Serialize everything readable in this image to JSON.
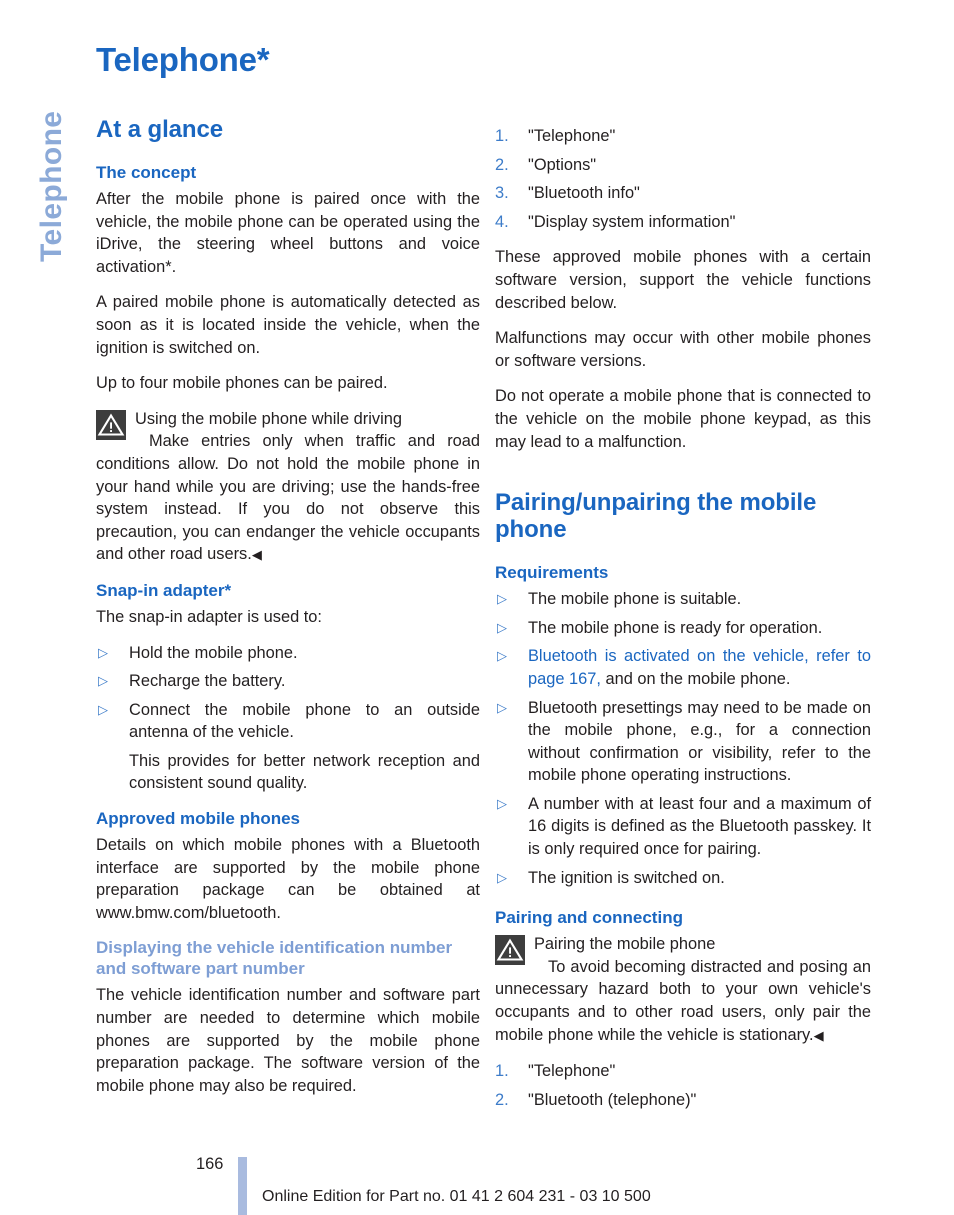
{
  "colors": {
    "heading_blue": "#1a66c0",
    "heading_blue_light": "#7e9ed4",
    "marker_blue": "#3d7cc9",
    "side_tab_blue": "#8caad8",
    "footer_bar": "#a9bbdf",
    "warning_icon_bg": "#3d3d3d",
    "body_text": "#231f20"
  },
  "side_tab": {
    "label": "Telephone"
  },
  "title": "Telephone*",
  "left_column": {
    "section_heading": "At a glance",
    "sub1": {
      "heading": "The concept",
      "paragraphs": [
        "After the mobile phone is paired once with the vehicle, the mobile phone can be operated using the iDrive, the steering wheel buttons and voice activation*.",
        "A paired mobile phone is automatically detected as soon as it is located inside the vehicle, when the ignition is switched on.",
        "Up to four mobile phones can be paired."
      ]
    },
    "warning": {
      "icon": "warning-triangle-icon",
      "title": "Using the mobile phone while driving",
      "body": "Make entries only when traffic and road conditions allow. Do not hold the mobile phone in your hand while you are driving; use the hands-free system instead. If you do not observe this precaution, you can endanger the vehicle occupants and other road users.",
      "end_marker": "◀"
    },
    "sub2": {
      "heading": "Snap-in adapter*",
      "intro": "The snap-in adapter is used to:",
      "bullets": [
        {
          "marker": "▷",
          "text": "Hold the mobile phone."
        },
        {
          "marker": "▷",
          "text": "Recharge the battery."
        },
        {
          "marker": "▷",
          "text": "Connect the mobile phone to an outside antenna of the vehicle."
        }
      ],
      "continuation": "This provides for better network reception and consistent sound quality."
    },
    "sub3": {
      "heading": "Approved mobile phones",
      "paragraph": "Details on which mobile phones with a Bluetooth interface are supported by the mobile phone preparation package can be obtained at www.bmw.com/bluetooth."
    },
    "sub4": {
      "heading": "Displaying the vehicle identification number and software part number",
      "paragraph": "The vehicle identification number and software part number are needed to determine which mobile phones are supported by the mobile phone preparation package. The software version of the mobile phone may also be required."
    }
  },
  "right_column": {
    "steps_top": [
      {
        "num": "1.",
        "text": "\"Telephone\""
      },
      {
        "num": "2.",
        "text": "\"Options\""
      },
      {
        "num": "3.",
        "text": "\"Bluetooth info\""
      },
      {
        "num": "4.",
        "text": "\"Display system information\""
      }
    ],
    "paragraphs": [
      "These approved mobile phones with a certain software version, support the vehicle functions described below.",
      "Malfunctions may occur with other mobile phones or software versions.",
      "Do not operate a mobile phone that is connected to the vehicle on the mobile phone keypad, as this may lead to a malfunction."
    ],
    "section_heading": "Pairing/unpairing the mobile phone",
    "requirements": {
      "heading": "Requirements",
      "bullets": [
        {
          "marker": "▷",
          "text": "The mobile phone is suitable."
        },
        {
          "marker": "▷",
          "text": "The mobile phone is ready for operation."
        },
        {
          "marker": "▷",
          "link_text": "Bluetooth is activated on the vehicle, refer to page 167,",
          "text": " and on the mobile phone."
        },
        {
          "marker": "▷",
          "text": "Bluetooth presettings may need to be made on the mobile phone, e.g., for a connection without confirmation or visibility, refer to the mobile phone operating instructions."
        },
        {
          "marker": "▷",
          "text": "A number with at least four and a maximum of 16 digits is defined as the Bluetooth passkey. It is only required once for pairing."
        },
        {
          "marker": "▷",
          "text": "The ignition is switched on."
        }
      ]
    },
    "pairing": {
      "heading": "Pairing and connecting",
      "warning": {
        "icon": "warning-triangle-icon",
        "title": "Pairing the mobile phone",
        "body": "To avoid becoming distracted and posing an unnecessary hazard both to your own vehicle's occupants and to other road users, only pair the mobile phone while the vehicle is stationary.",
        "end_marker": "◀"
      },
      "steps": [
        {
          "num": "1.",
          "text": "\"Telephone\""
        },
        {
          "num": "2.",
          "text": "\"Bluetooth (telephone)\""
        }
      ]
    }
  },
  "footer": {
    "page_number": "166",
    "edition_text": "Online Edition for Part no. 01 41 2 604 231 - 03 10 500"
  }
}
